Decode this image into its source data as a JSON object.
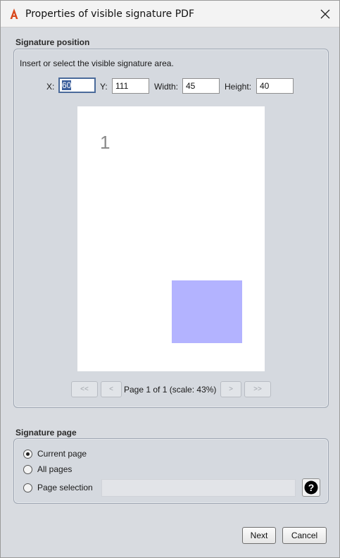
{
  "window": {
    "title": "Properties of visible signature PDF",
    "app_icon": "acrobat-icon",
    "close_icon": "close-icon"
  },
  "signature_position": {
    "group_label": "Signature position",
    "instruction": "Insert or select the visible signature area.",
    "x_label": "X:",
    "x_value": "60",
    "y_label": "Y:",
    "y_value": "111",
    "width_label": "Width:",
    "width_value": "45",
    "height_label": "Height:",
    "height_value": "40",
    "preview": {
      "page_number": "1",
      "signature_area_color": "#b3b3ff"
    },
    "pagination": {
      "first_label": "<<",
      "prev_label": "<",
      "status": "Page 1 of 1 (scale: 43%)",
      "next_label": ">",
      "last_label": ">>"
    }
  },
  "signature_page": {
    "group_label": "Signature page",
    "options": [
      {
        "label": "Current page",
        "selected": true
      },
      {
        "label": "All pages",
        "selected": false
      },
      {
        "label": "Page selection",
        "selected": false
      }
    ],
    "page_selection_value": "",
    "help_icon": "question-mark-icon"
  },
  "footer": {
    "next_label": "Next",
    "cancel_label": "Cancel"
  }
}
